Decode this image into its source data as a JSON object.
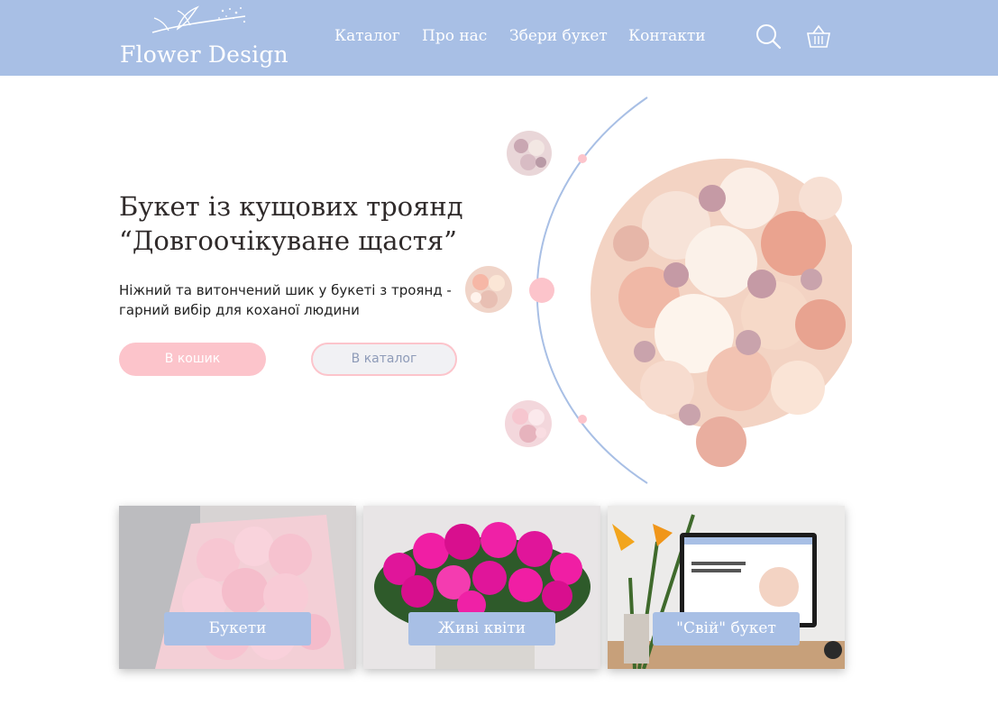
{
  "header": {
    "logo_text": "Flower Design",
    "nav": [
      "Каталог",
      "Про нас",
      "Збери букет",
      "Контакти"
    ],
    "search_icon": "search-icon",
    "cart_icon": "basket-icon"
  },
  "hero": {
    "title_line1": "Букет із кущових троянд",
    "title_line2": "“Довгоочікуване щастя”",
    "subtitle_line1": "Ніжний та витончений шик у букеті з троянд -",
    "subtitle_line2": "гарний вибір для коханої людини",
    "cart_button": "В кошик",
    "catalog_button": "В каталог"
  },
  "categories": [
    {
      "label": "Букети"
    },
    {
      "label": "Живі квіти"
    },
    {
      "label": "\"Свій\" букет"
    }
  ],
  "colors": {
    "header_bg": "#a8bfe5",
    "accent_pink": "#fcc4cb",
    "text_dark": "#2f2a2a"
  }
}
